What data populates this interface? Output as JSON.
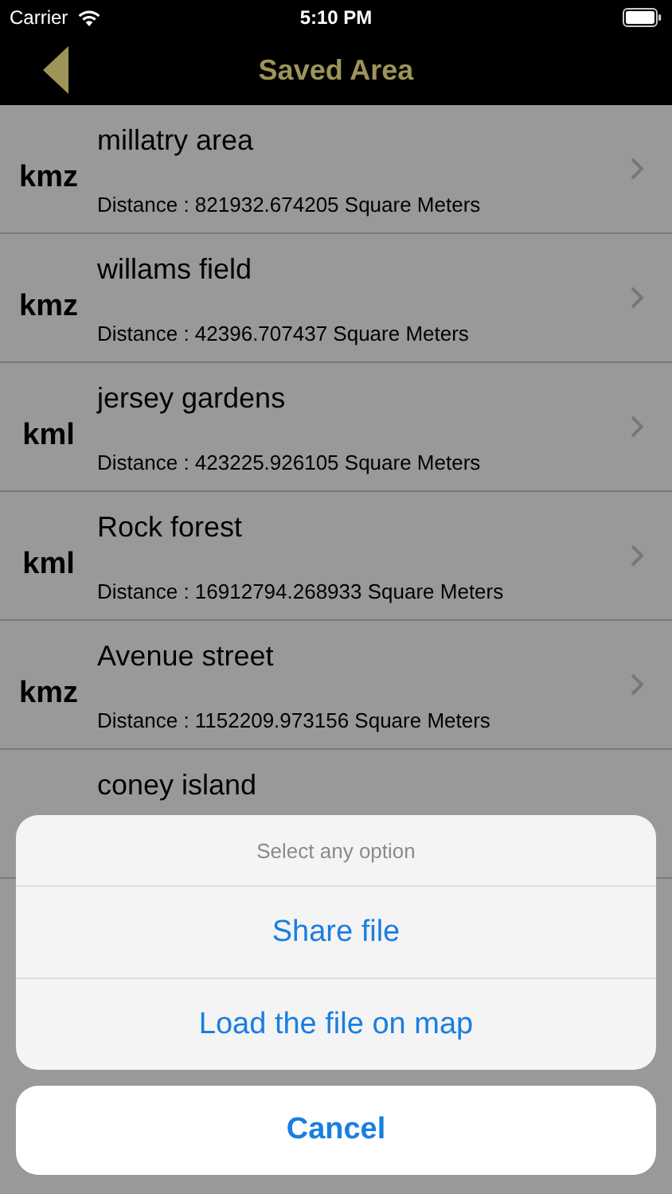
{
  "status_bar": {
    "carrier": "Carrier",
    "time": "5:10 PM"
  },
  "nav": {
    "title": "Saved Area"
  },
  "rows": [
    {
      "type": "kmz",
      "title": "millatry area",
      "distance": "Distance : 821932.674205 Square Meters"
    },
    {
      "type": "kmz",
      "title": "willams field",
      "distance": "Distance : 42396.707437 Square Meters"
    },
    {
      "type": "kml",
      "title": "jersey gardens",
      "distance": "Distance : 423225.926105 Square Meters"
    },
    {
      "type": "kml",
      "title": "Rock forest",
      "distance": "Distance : 16912794.268933 Square Meters"
    },
    {
      "type": "kmz",
      "title": "Avenue street",
      "distance": "Distance : 1152209.973156 Square Meters"
    },
    {
      "title": "coney island"
    }
  ],
  "action_sheet": {
    "title": "Select any option",
    "options": [
      "Share file",
      "Load the file on map"
    ],
    "cancel": "Cancel"
  }
}
